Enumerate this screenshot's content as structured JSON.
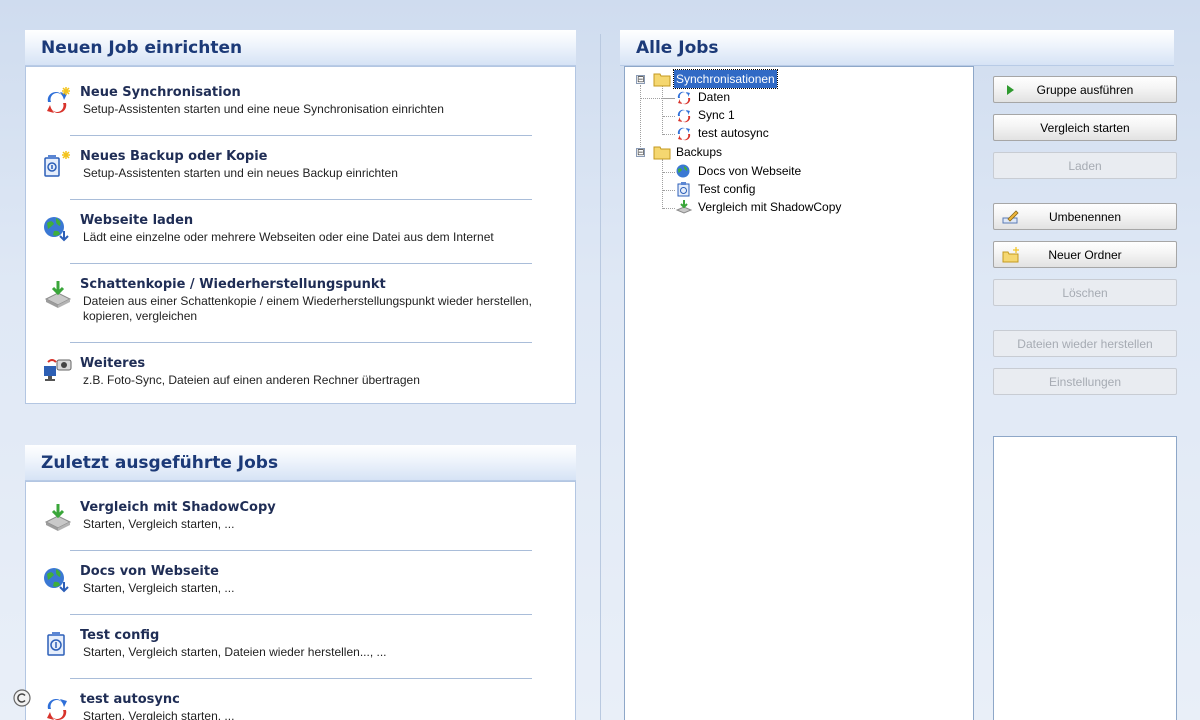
{
  "new_job": {
    "title": "Neuen Job einrichten",
    "items": [
      {
        "icon": "sync-new-icon",
        "title": "Neue Synchronisation",
        "desc": "Setup-Assistenten starten und eine neue Synchronisation einrichten"
      },
      {
        "icon": "backup-new-icon",
        "title": "Neues Backup oder Kopie",
        "desc": "Setup-Assistenten starten und ein neues Backup einrichten"
      },
      {
        "icon": "web-download-icon",
        "title": "Webseite laden",
        "desc": "Lädt eine einzelne oder mehrere Webseiten oder eine Datei aus dem Internet"
      },
      {
        "icon": "shadow-copy-icon",
        "title": "Schattenkopie / Wiederherstellungspunkt",
        "desc": "Dateien aus einer Schattenkopie / einem Wiederherstellungspunkt wieder herstellen, kopieren, vergleichen"
      },
      {
        "icon": "more-tools-icon",
        "title": "Weiteres",
        "desc": "z.B. Foto-Sync, Dateien auf einen anderen Rechner übertragen"
      }
    ]
  },
  "recent_jobs": {
    "title": "Zuletzt ausgeführte Jobs",
    "items": [
      {
        "icon": "shadow-copy-icon",
        "title": "Vergleich mit ShadowCopy",
        "desc": "Starten, Vergleich starten, ..."
      },
      {
        "icon": "web-download-icon",
        "title": "Docs von Webseite",
        "desc": "Starten, Vergleich starten, ..."
      },
      {
        "icon": "backup-icon",
        "title": "Test config",
        "desc": "Starten, Vergleich starten, Dateien wieder herstellen..., ..."
      },
      {
        "icon": "sync-icon",
        "title": "test autosync",
        "desc": "Starten, Vergleich starten, ..."
      }
    ]
  },
  "all_jobs": {
    "title": "Alle Jobs",
    "tree": [
      {
        "label": "Synchronisationen",
        "icon": "folder-icon",
        "expander": "⊟",
        "selected": true,
        "children": [
          {
            "label": "Daten",
            "icon": "sync-job-icon"
          },
          {
            "label": "Sync 1",
            "icon": "sync-job-icon"
          },
          {
            "label": "test autosync",
            "icon": "sync-job-icon"
          }
        ]
      },
      {
        "label": "Backups",
        "icon": "folder-icon",
        "expander": "⊟",
        "selected": false,
        "children": [
          {
            "label": "Docs von Webseite",
            "icon": "web-job-icon"
          },
          {
            "label": "Test config",
            "icon": "backup-job-icon"
          },
          {
            "label": "Vergleich mit ShadowCopy",
            "icon": "shadow-job-icon"
          }
        ]
      }
    ]
  },
  "buttons": [
    {
      "label": "Gruppe ausführen",
      "icon": "play-icon",
      "enabled": true
    },
    {
      "label": "Vergleich starten",
      "icon": "",
      "enabled": true
    },
    {
      "label": "Laden",
      "icon": "",
      "enabled": false
    },
    {
      "label": "Umbenennen",
      "icon": "rename-icon",
      "enabled": true
    },
    {
      "label": "Neuer Ordner",
      "icon": "new-folder-icon",
      "enabled": true
    },
    {
      "label": "Löschen",
      "icon": "",
      "enabled": false
    },
    {
      "label": "Dateien wieder herstellen",
      "icon": "",
      "enabled": false
    },
    {
      "label": "Einstellungen",
      "icon": "",
      "enabled": false
    }
  ],
  "colors": {
    "heading": "#1c3a78",
    "item_title": "#1f2d55",
    "selection": "#316ac5",
    "background": "#dfe8f5"
  }
}
